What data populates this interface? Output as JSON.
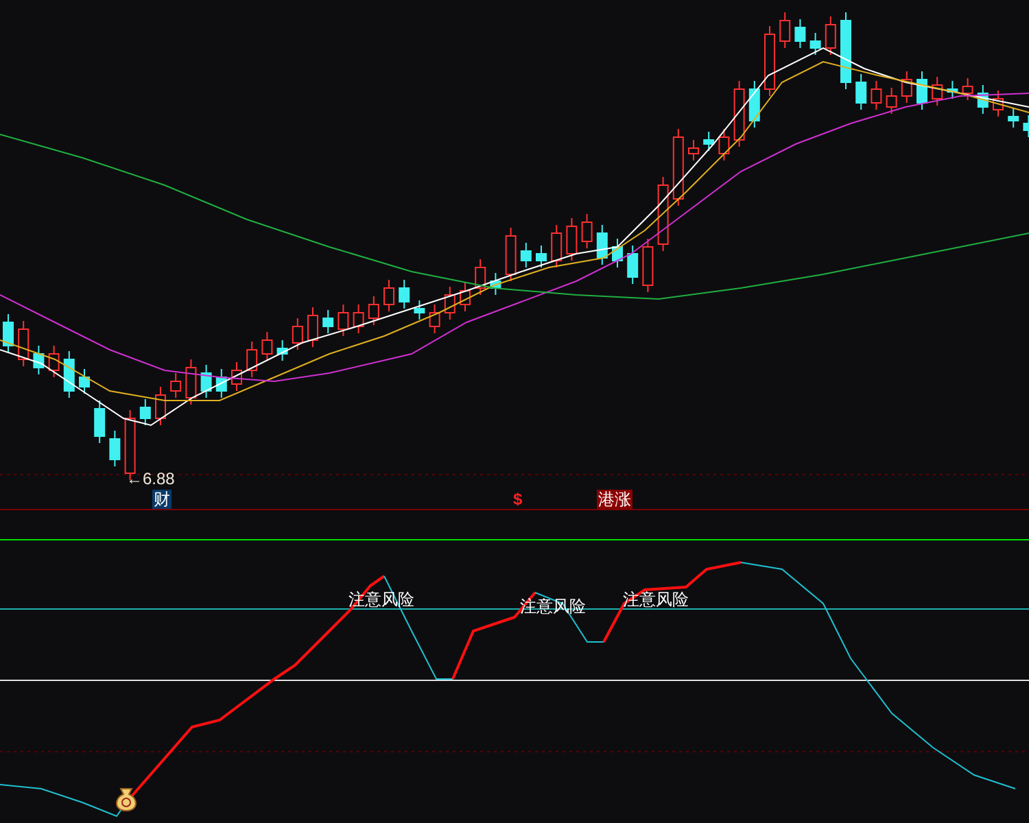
{
  "price_panel": {
    "low_label": "←6.88",
    "markers": [
      {
        "text": "财",
        "kind": "finance"
      },
      {
        "text": "$",
        "kind": "dollar"
      },
      {
        "text": "港涨",
        "kind": "hk"
      }
    ]
  },
  "indicator_panel": {
    "alerts": [
      "注意风险",
      "注意风险",
      "注意风险"
    ]
  }
}
